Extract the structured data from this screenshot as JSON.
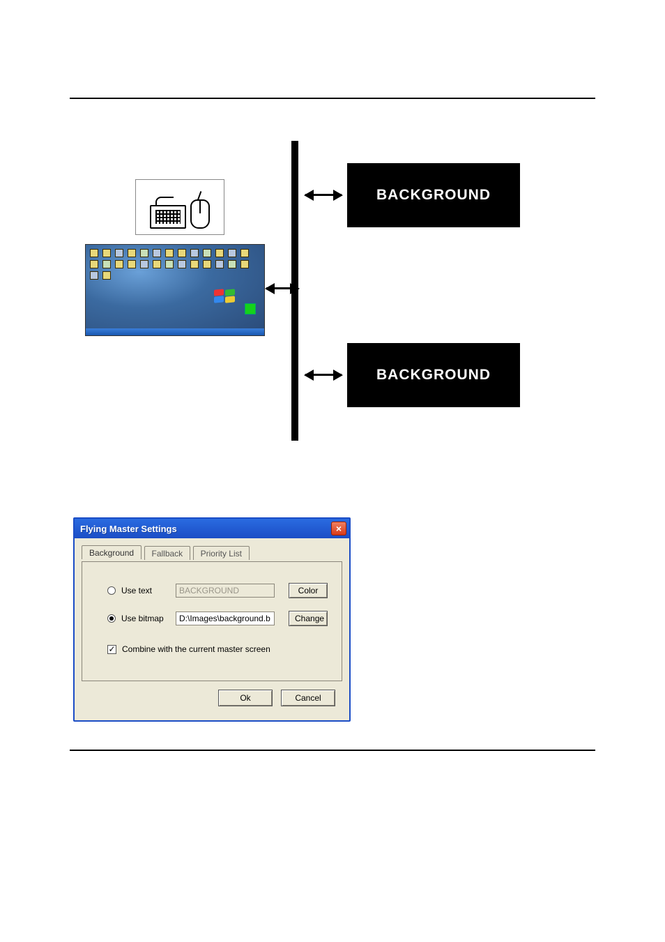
{
  "diagram": {
    "background_label": "BACKGROUND"
  },
  "dialog": {
    "title": "Flying Master Settings",
    "close_btn_text": "×",
    "tabs": {
      "background": "Background",
      "fallback": "Fallback",
      "priority": "Priority List"
    },
    "use_text_label": "Use text",
    "use_text_value": "BACKGROUND",
    "color_btn": "Color",
    "use_bitmap_label": "Use bitmap",
    "use_bitmap_value": "D:\\Images\\background.b",
    "change_btn": "Change",
    "combine_label": "Combine with the current master screen",
    "ok_btn": "Ok",
    "cancel_btn": "Cancel"
  }
}
